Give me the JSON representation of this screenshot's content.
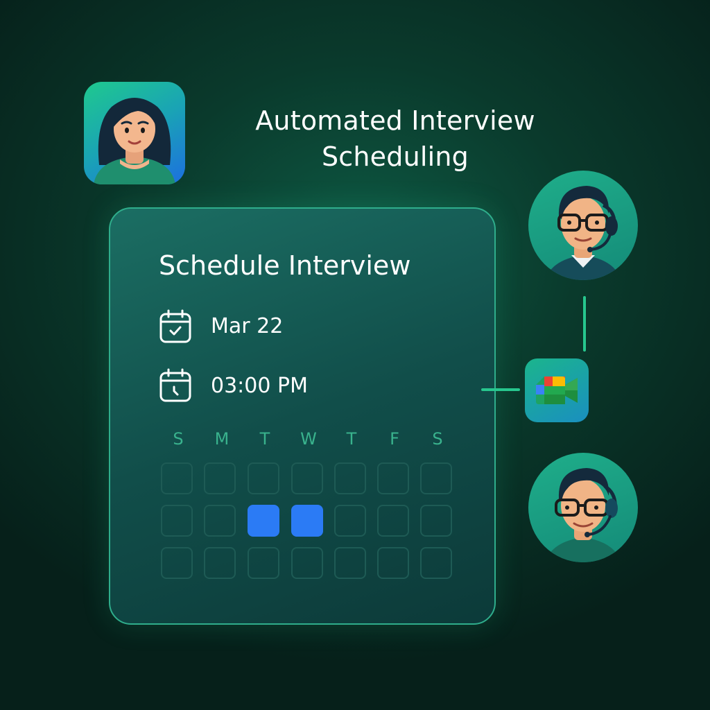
{
  "headline": {
    "line1": "Automated Interview",
    "line2": "Scheduling"
  },
  "card": {
    "title": "Schedule Interview",
    "date_icon": "calendar-check-icon",
    "date": "Mar 22",
    "time_icon": "calendar-clock-icon",
    "time": "03:00 PM",
    "weekdays": [
      "S",
      "M",
      "T",
      "W",
      "T",
      "F",
      "S"
    ],
    "selected_cells": [
      [
        1,
        2
      ],
      [
        1,
        3
      ]
    ]
  },
  "avatars": {
    "candidate": "candidate-avatar",
    "interviewer_1": "interviewer-avatar-headset",
    "interviewer_2": "interviewer-avatar-headset"
  },
  "meet_icon": "google-meet-icon",
  "colors": {
    "accent": "#27c78e",
    "selected": "#2b7bf5",
    "weekday": "#39b28d"
  }
}
